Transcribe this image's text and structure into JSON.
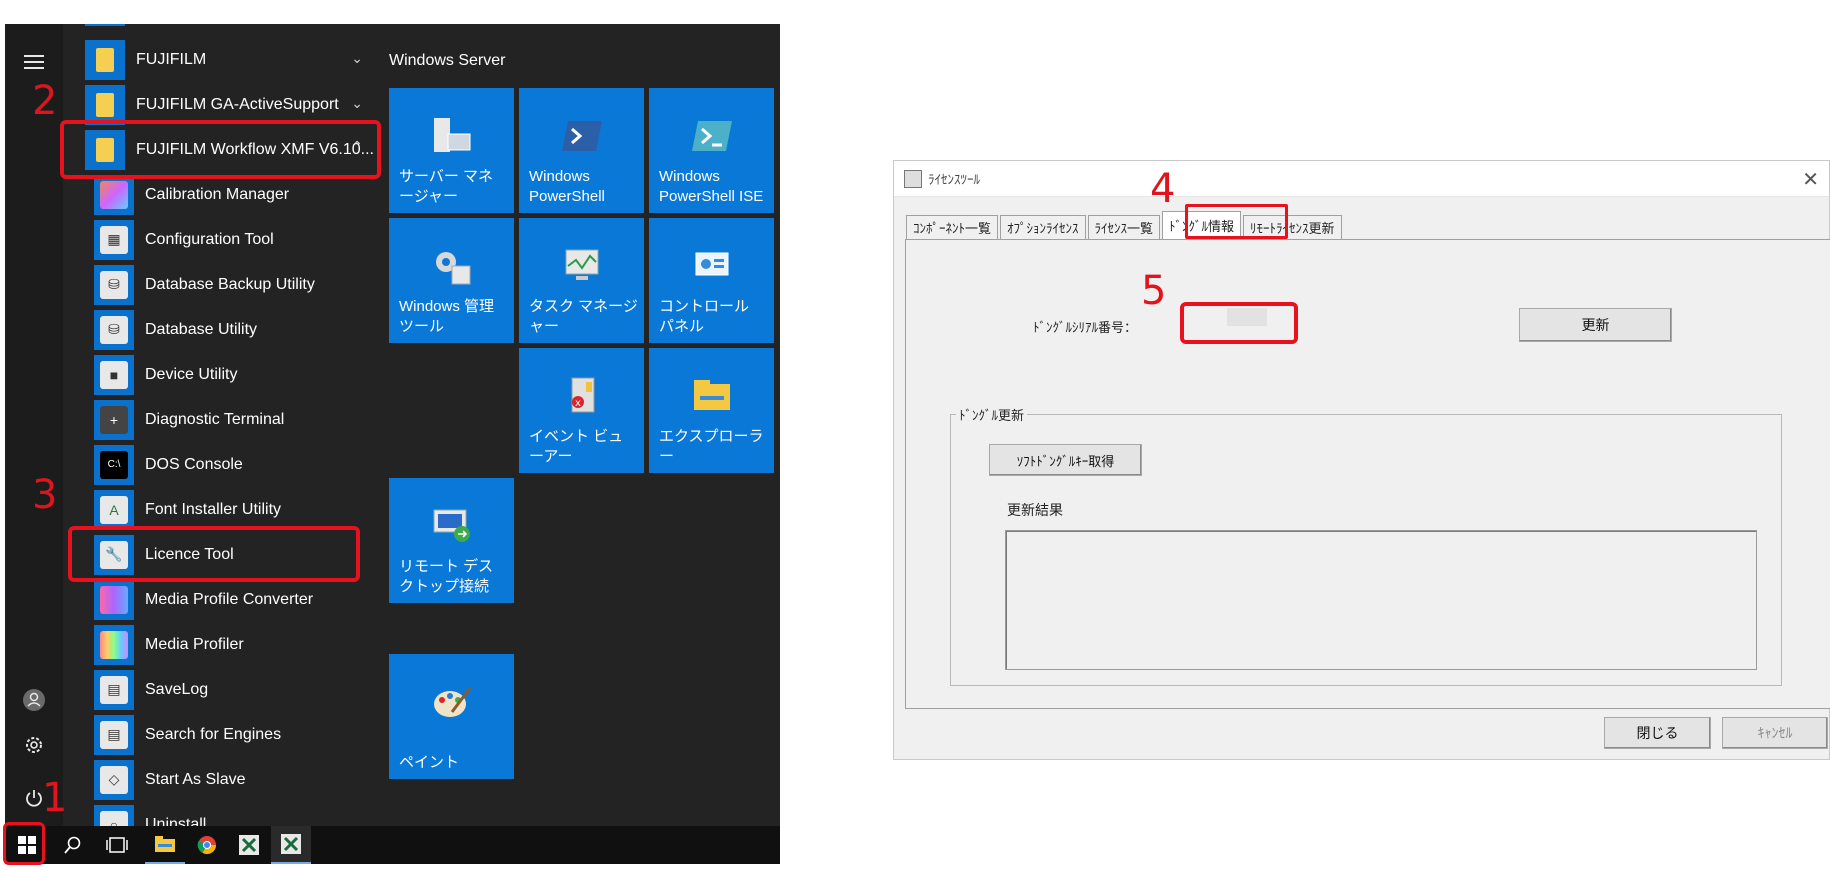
{
  "start_menu": {
    "folders": [
      {
        "label": "FUJIFILM",
        "chevron": "chevron-down"
      },
      {
        "label": "FUJIFILM GA-ActiveSupport",
        "chevron": "chevron-down"
      },
      {
        "label": "FUJIFILM Workflow XMF V6.10...",
        "chevron": "chevron-up"
      }
    ],
    "apps": [
      {
        "label": "Calibration Manager",
        "icon": "calibration-icon"
      },
      {
        "label": "Configuration Tool",
        "icon": "configuration-icon"
      },
      {
        "label": "Database Backup Utility",
        "icon": "database-backup-icon"
      },
      {
        "label": "Database Utility",
        "icon": "database-icon"
      },
      {
        "label": "Device Utility",
        "icon": "device-icon"
      },
      {
        "label": "Diagnostic Terminal",
        "icon": "diagnostic-icon"
      },
      {
        "label": "DOS Console",
        "icon": "console-icon"
      },
      {
        "label": "Font Installer Utility",
        "icon": "font-installer-icon"
      },
      {
        "label": "Licence Tool",
        "icon": "licence-tool-icon"
      },
      {
        "label": "Media Profile Converter",
        "icon": "media-profile-converter-icon"
      },
      {
        "label": "Media Profiler",
        "icon": "media-profiler-icon"
      },
      {
        "label": "SaveLog",
        "icon": "savelog-icon"
      },
      {
        "label": "Search for Engines",
        "icon": "search-engines-icon"
      },
      {
        "label": "Start As Slave",
        "icon": "start-as-slave-icon"
      },
      {
        "label": "Uninstall",
        "icon": "uninstall-icon"
      }
    ],
    "tiles_group": "Windows Server",
    "tiles": [
      {
        "label": "サーバー マネージャー",
        "icon": "server-manager-icon"
      },
      {
        "label": "Windows PowerShell",
        "icon": "powershell-icon"
      },
      {
        "label": "Windows PowerShell ISE",
        "icon": "powershell-ise-icon"
      },
      {
        "label": "Windows 管理ツール",
        "icon": "admin-tools-icon"
      },
      {
        "label": "タスク マネージャー",
        "icon": "task-manager-icon"
      },
      {
        "label": "コントロール パネル",
        "icon": "control-panel-icon"
      },
      {
        "label": "イベント ビューアー",
        "icon": "event-viewer-icon"
      },
      {
        "label": "エクスプローラー",
        "icon": "explorer-icon"
      },
      {
        "label": "リモート デスクトップ接続",
        "icon": "remote-desktop-icon"
      },
      {
        "label": "ペイント",
        "icon": "paint-icon"
      }
    ]
  },
  "taskbar": {
    "items": [
      "start-icon",
      "search-icon",
      "task-view-icon",
      "file-explorer-icon",
      "chrome-icon",
      "xmf-icon",
      "xmf-active-icon"
    ]
  },
  "annotations": {
    "n1": "1",
    "n2": "2",
    "n3": "3",
    "n4": "4",
    "n5": "5"
  },
  "dialog": {
    "title": "ﾗｲｾﾝｽﾂｰﾙ",
    "tabs": [
      "ｺﾝﾎﾟｰﾈﾝﾄ一覧",
      "ｵﾌﾟｼｮﾝﾗｲｾﾝｽ",
      "ﾗｲｾﾝｽ一覧",
      "ﾄﾞﾝｸﾞﾙ情報",
      "ﾘﾓｰﾄﾗｲｾﾝｽ更新"
    ],
    "active_tab": "ﾄﾞﾝｸﾞﾙ情報",
    "serial_label": "ﾄﾞﾝｸﾞﾙｼﾘｱﾙ番号：",
    "refresh_button": "更新",
    "group_caption": "ﾄﾞﾝｸﾞﾙ更新",
    "get_key_button": "ｿﾌﾄﾄﾞﾝｸﾞﾙｷｰ取得",
    "result_label": "更新結果",
    "close_button": "閉じる",
    "cancel_button": "ｷｬﾝｾﾙ"
  },
  "colors": {
    "tile_blue": "#0a78d7",
    "highlight_red": "#e8111e",
    "menu_bg": "#232323"
  }
}
